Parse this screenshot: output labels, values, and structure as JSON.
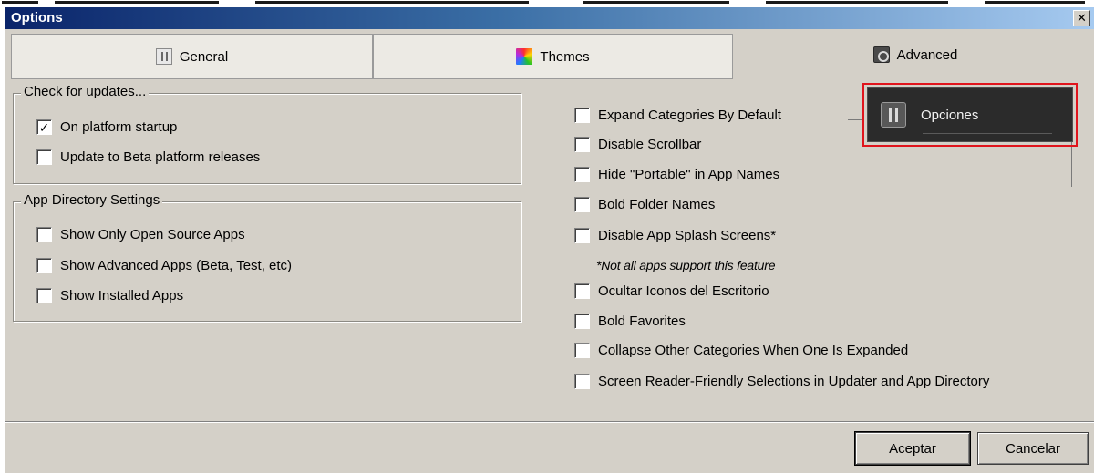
{
  "window": {
    "title": "Options",
    "close_glyph": "✕"
  },
  "tabs": [
    {
      "label": "General",
      "icon": "general-icon",
      "active": false
    },
    {
      "label": "Themes",
      "icon": "themes-icon",
      "active": false
    },
    {
      "label": "Advanced",
      "icon": "advanced-icon",
      "active": true
    }
  ],
  "updates_group": {
    "legend": "Check for updates...",
    "items": [
      {
        "label": "On platform startup",
        "checked": true
      },
      {
        "label": "Update to Beta platform releases",
        "checked": false
      }
    ]
  },
  "app_directory_group": {
    "legend": "App Directory Settings",
    "items": [
      {
        "label": "Show Only Open Source Apps",
        "checked": false
      },
      {
        "label": "Show Advanced Apps (Beta, Test, etc)",
        "checked": false
      },
      {
        "label": "Show Installed Apps",
        "checked": false
      }
    ]
  },
  "advanced_options": [
    {
      "label": "Expand Categories By Default",
      "checked": false
    },
    {
      "label": "Disable Scrollbar",
      "checked": false
    },
    {
      "label": "Hide \"Portable\" in App Names",
      "checked": false
    },
    {
      "label": "Bold Folder Names",
      "checked": false
    },
    {
      "label": "Disable App Splash Screens*",
      "checked": false
    },
    {
      "label": "Ocultar Iconos del Escritorio",
      "checked": false
    },
    {
      "label": "Bold Favorites",
      "checked": false
    },
    {
      "label": "Collapse Other Categories When One Is Expanded",
      "checked": false
    },
    {
      "label": "Screen Reader-Friendly Selections in Updater and App Directory",
      "checked": false
    }
  ],
  "splash_note": "*Not all apps support this feature",
  "preview": {
    "label": "Opciones",
    "highlight_color": "#e0141c"
  },
  "buttons": {
    "accept": "Aceptar",
    "cancel": "Cancelar"
  },
  "colors": {
    "dialog_bg": "#d4d0c8",
    "titlebar_start": "#0a246a",
    "titlebar_end": "#a6caf0"
  }
}
